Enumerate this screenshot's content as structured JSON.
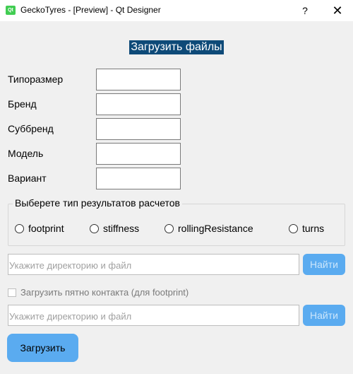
{
  "window": {
    "title": "GeckoTyres - [Preview] - Qt Designer",
    "app_icon_text": "Qt",
    "help_glyph": "?",
    "close_glyph": "✕"
  },
  "header": {
    "title": "Загрузить файлы"
  },
  "fields": [
    {
      "label": "Типоразмер",
      "value": ""
    },
    {
      "label": "Бренд",
      "value": ""
    },
    {
      "label": "Суббренд",
      "value": ""
    },
    {
      "label": "Модель",
      "value": ""
    },
    {
      "label": "Вариант",
      "value": ""
    }
  ],
  "results_group": {
    "title": "Выберете тип результатов расчетов",
    "options": [
      "footprint",
      "stiffness",
      "rollingResistance",
      "turns"
    ]
  },
  "path1": {
    "placeholder": "Укажите директорию и файл",
    "button": "Найти"
  },
  "contact_patch": {
    "label": "Загрузить пятно контакта (для footprint)",
    "checked": false
  },
  "path2": {
    "placeholder": "Укажите директорию и файл",
    "button": "Найти"
  },
  "upload_button": "Загрузить"
}
